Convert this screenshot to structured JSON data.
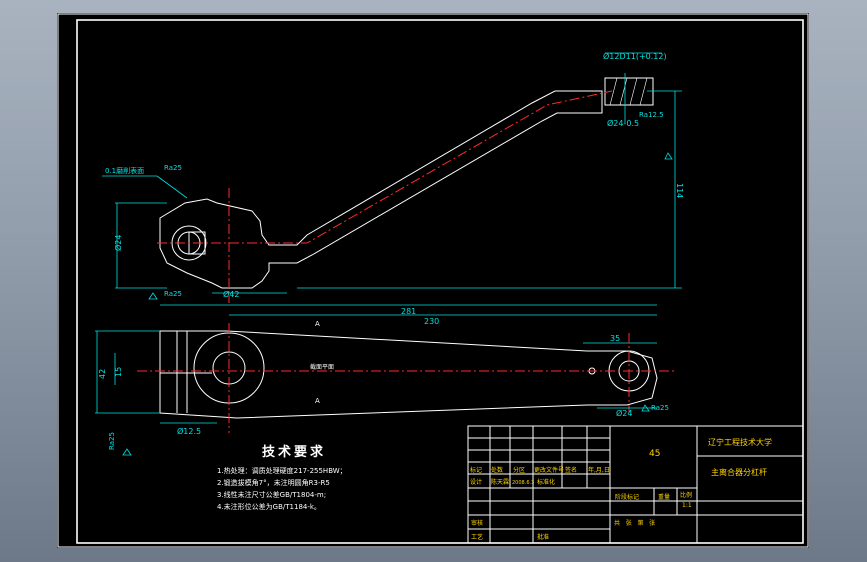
{
  "drawing": {
    "title_block": {
      "material": "45",
      "school": "辽宁工程技术大学",
      "part_name": "主离合器分杠杆",
      "scale": "1:1",
      "cells": {
        "mark": "标记",
        "count": "处数",
        "zone": "分区",
        "doc_no": "更改文件号",
        "sign": "签名",
        "date": "年,月,日",
        "design": "设计",
        "designer": "陈天霖",
        "design_date": "2008.6.3",
        "standard": "标准化",
        "stage_mark": "阶段标记",
        "weight": "重量",
        "scale_label": "比例",
        "review": "审核",
        "process": "工艺",
        "approve": "批准",
        "sheets": "共   张   第   张"
      }
    },
    "tech_req": {
      "heading": "技术要求",
      "items": [
        "1.热处理：调质处理硬度217-255HBW；",
        "2.锻造拔模角7°，未注明圆角R3-R5",
        "3.线性未注尺寸公差GB/T1804-m;",
        "4.未注形位公差为GB/T1184-k。"
      ]
    },
    "dims": {
      "d_hole_top": "Ø12D11(+0.12)",
      "d_boss_top": "Ø24-0.5",
      "d_top_ra": "Ra12.5",
      "h_114": "114",
      "d_left": "Ø24",
      "d_42": "Ø42",
      "ra_left": "Ra25",
      "surface_note": "0.1磨削表面",
      "ra_note": "Ra25",
      "l_281": "281",
      "l_230": "230",
      "l_35": "35",
      "d_12_5": "Ø12.5",
      "d_28": "Ø24",
      "ra_right": "Ra25",
      "h_42": "42",
      "h_15": "15",
      "ra_lower_left": "Ra25",
      "center_label": "截面平面",
      "section_a": "A",
      "section_a2": "A"
    }
  },
  "colors": {
    "background": "#000000",
    "line": "#ffffff",
    "dimension": "#00e0e0",
    "centerline": "#ff2a2a",
    "text_title": "#ffd400"
  }
}
